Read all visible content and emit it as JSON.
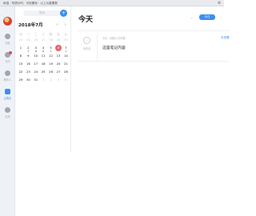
{
  "topbar": {
    "text": "雨温 · 有提示时，可设置标 · 以上为重要数",
    "close_glyph": "⊗"
  },
  "sidebar": {
    "items": [
      {
        "label": "消息",
        "icon": "chat-bubble-icon"
      },
      {
        "label": "日历",
        "icon": "calendar-icon",
        "badge": true
      },
      {
        "label": "联系人",
        "icon": "contacts-icon"
      },
      {
        "label": "云笔记",
        "icon": "note-icon",
        "active": true
      },
      {
        "label": "应用",
        "icon": "apps-icon"
      }
    ]
  },
  "calendar": {
    "search_placeholder": "搜索",
    "add_label": "+",
    "prev_label": "<",
    "next_label": ">",
    "month_title": "2018年7月",
    "weekdays": [
      "日",
      "一",
      "二",
      "三",
      "四",
      "五",
      "六"
    ],
    "weeks": [
      [
        "24",
        "25",
        "26",
        "27",
        "28",
        "29",
        "30"
      ],
      [
        "1",
        "2",
        "3",
        "4",
        "5",
        "6",
        "7"
      ],
      [
        "8",
        "9",
        "10",
        "11",
        "12",
        "13",
        "14"
      ],
      [
        "15",
        "16",
        "17",
        "18",
        "19",
        "20",
        "21"
      ],
      [
        "22",
        "23",
        "24",
        "25",
        "26",
        "27",
        "28"
      ],
      [
        "29",
        "30",
        "31",
        "1",
        "2",
        "3",
        "4"
      ]
    ],
    "today": "6",
    "dotted_days": [
      "2",
      "3",
      "4",
      "5",
      "7"
    ]
  },
  "main": {
    "title": "今天",
    "chevron": "⌄",
    "today_button": "今日",
    "grip": "⋮",
    "note": {
      "status_glyph": "✓",
      "status_label": "待完成",
      "meta": "今天 · 回到入口列表",
      "body": "这是笔记内容",
      "link": "去查看"
    }
  },
  "colors": {
    "accent": "#3d8ff0",
    "today_circle": "#e8676a",
    "badge": "#e94b45"
  }
}
